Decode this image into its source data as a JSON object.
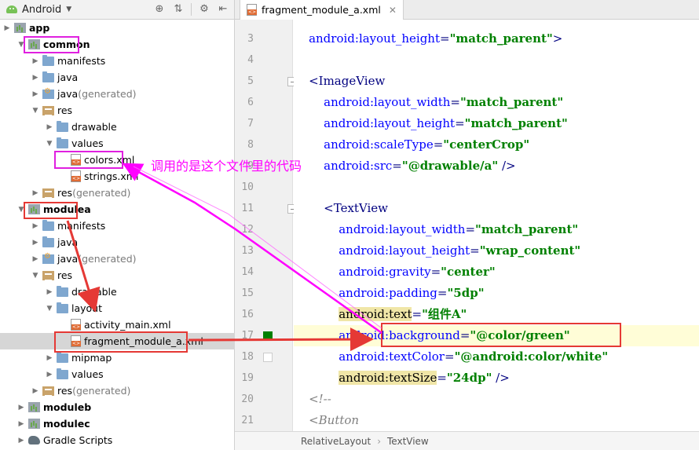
{
  "project_panel": {
    "view_selector": "Android",
    "tree": [
      {
        "label": "app",
        "suffix": "",
        "icon": "module-icon",
        "bold": true,
        "expanded": false
      },
      {
        "label": "common",
        "suffix": "",
        "icon": "module-icon",
        "bold": true,
        "expanded": true
      },
      {
        "label": "manifests",
        "suffix": "",
        "icon": "folder-icon",
        "expanded": false
      },
      {
        "label": "java",
        "suffix": "",
        "icon": "folder-icon",
        "expanded": false
      },
      {
        "label": "java",
        "suffix": " (generated)",
        "icon": "java-generated-folder-icon",
        "expanded": false
      },
      {
        "label": "res",
        "suffix": "",
        "icon": "res-folder-icon",
        "expanded": true
      },
      {
        "label": "drawable",
        "suffix": "",
        "icon": "folder-icon",
        "expanded": false
      },
      {
        "label": "values",
        "suffix": "",
        "icon": "folder-icon",
        "expanded": true
      },
      {
        "label": "colors.xml",
        "suffix": "",
        "icon": "xml-file-icon"
      },
      {
        "label": "strings.xml",
        "suffix": "",
        "icon": "xml-file-icon"
      },
      {
        "label": "res",
        "suffix": " (generated)",
        "icon": "res-folder-icon",
        "expanded": false
      },
      {
        "label": "modulea",
        "suffix": "",
        "icon": "module-icon",
        "bold": true,
        "expanded": true
      },
      {
        "label": "manifests",
        "suffix": "",
        "icon": "folder-icon",
        "expanded": false
      },
      {
        "label": "java",
        "suffix": "",
        "icon": "folder-icon",
        "expanded": false
      },
      {
        "label": "java",
        "suffix": " (generated)",
        "icon": "java-generated-folder-icon",
        "expanded": false
      },
      {
        "label": "res",
        "suffix": "",
        "icon": "res-folder-icon",
        "expanded": true
      },
      {
        "label": "drawable",
        "suffix": "",
        "icon": "folder-icon",
        "expanded": false
      },
      {
        "label": "layout",
        "suffix": "",
        "icon": "folder-icon",
        "expanded": true
      },
      {
        "label": "activity_main.xml",
        "suffix": "",
        "icon": "xml-file-icon"
      },
      {
        "label": "fragment_module_a.xml",
        "suffix": "",
        "icon": "xml-file-icon",
        "selected": true
      },
      {
        "label": "mipmap",
        "suffix": "",
        "icon": "folder-icon",
        "expanded": false
      },
      {
        "label": "values",
        "suffix": "",
        "icon": "folder-icon",
        "expanded": false
      },
      {
        "label": "res",
        "suffix": " (generated)",
        "icon": "res-folder-icon",
        "expanded": false
      },
      {
        "label": "moduleb",
        "suffix": "",
        "icon": "module-icon",
        "bold": true,
        "expanded": false
      },
      {
        "label": "modulec",
        "suffix": "",
        "icon": "module-icon",
        "bold": true,
        "expanded": false
      },
      {
        "label": "Gradle Scripts",
        "suffix": "",
        "icon": "gradle-icon",
        "expanded": false
      }
    ]
  },
  "editor": {
    "tab_title": "fragment_module_a.xml",
    "breadcrumb": [
      "RelativeLayout",
      "TextView"
    ],
    "lines": [
      {
        "n": "3",
        "indent": "    ",
        "parts": [
          [
            "attr",
            "android:layout_height"
          ],
          [
            "punc",
            "="
          ],
          [
            "val",
            "\"match_parent\""
          ],
          [
            "punc",
            ">"
          ]
        ]
      },
      {
        "n": "4",
        "indent": "",
        "parts": []
      },
      {
        "n": "5",
        "indent": "    ",
        "parts": [
          [
            "tag",
            "<ImageView"
          ]
        ]
      },
      {
        "n": "6",
        "indent": "        ",
        "parts": [
          [
            "attr",
            "android:layout_width"
          ],
          [
            "punc",
            "="
          ],
          [
            "val",
            "\"match_parent\""
          ]
        ]
      },
      {
        "n": "7",
        "indent": "        ",
        "parts": [
          [
            "attr",
            "android:layout_height"
          ],
          [
            "punc",
            "="
          ],
          [
            "val",
            "\"match_parent\""
          ]
        ]
      },
      {
        "n": "8",
        "indent": "        ",
        "parts": [
          [
            "attr",
            "android:scaleType"
          ],
          [
            "punc",
            "="
          ],
          [
            "val",
            "\"centerCrop\""
          ]
        ]
      },
      {
        "n": "9",
        "indent": "        ",
        "parts": [
          [
            "attr",
            "android:src"
          ],
          [
            "punc",
            "="
          ],
          [
            "val",
            "\"@drawable/a\""
          ],
          [
            "punc",
            " />"
          ]
        ]
      },
      {
        "n": "10",
        "indent": "",
        "parts": []
      },
      {
        "n": "11",
        "indent": "        ",
        "parts": [
          [
            "tag",
            "<TextView"
          ]
        ]
      },
      {
        "n": "12",
        "indent": "            ",
        "parts": [
          [
            "attr",
            "android:layout_width"
          ],
          [
            "punc",
            "="
          ],
          [
            "val",
            "\"match_parent\""
          ]
        ]
      },
      {
        "n": "13",
        "indent": "            ",
        "parts": [
          [
            "attr",
            "android:layout_height"
          ],
          [
            "punc",
            "="
          ],
          [
            "val",
            "\"wrap_content\""
          ]
        ]
      },
      {
        "n": "14",
        "indent": "            ",
        "parts": [
          [
            "attr",
            "android:gravity"
          ],
          [
            "punc",
            "="
          ],
          [
            "val",
            "\"center\""
          ]
        ]
      },
      {
        "n": "15",
        "indent": "            ",
        "parts": [
          [
            "attr",
            "android:padding"
          ],
          [
            "punc",
            "="
          ],
          [
            "val",
            "\"5dp\""
          ]
        ]
      },
      {
        "n": "16",
        "indent": "            ",
        "parts": [
          [
            "hl-attr",
            "android:text"
          ],
          [
            "punc",
            "="
          ],
          [
            "val",
            "\"组件A\""
          ]
        ]
      },
      {
        "n": "17",
        "indent": "            ",
        "parts": [
          [
            "attr",
            "android:background"
          ],
          [
            "punc",
            "="
          ],
          [
            "val",
            "\"@color/green\""
          ]
        ],
        "current": true
      },
      {
        "n": "18",
        "indent": "            ",
        "parts": [
          [
            "attr",
            "android:textColor"
          ],
          [
            "punc",
            "="
          ],
          [
            "val",
            "\"@android:color/white\""
          ]
        ]
      },
      {
        "n": "19",
        "indent": "            ",
        "parts": [
          [
            "hl-attr",
            "android:textSize"
          ],
          [
            "punc",
            "="
          ],
          [
            "val",
            "\"24dp\""
          ],
          [
            "punc",
            " />"
          ]
        ]
      },
      {
        "n": "20",
        "indent": "    ",
        "parts": [
          [
            "cmt",
            "<!--"
          ]
        ]
      },
      {
        "n": "21",
        "indent": "    ",
        "parts": [
          [
            "cmt",
            "<Button"
          ]
        ]
      }
    ]
  },
  "annotation": {
    "text": "调用的是这个文件里的代码",
    "color": "#ff00ff"
  },
  "colors": {
    "magenta": "#ff00ff",
    "red": "#e53935",
    "xml_value": "#008000",
    "xml_attr": "#0000ff",
    "xml_tag": "#000080"
  }
}
